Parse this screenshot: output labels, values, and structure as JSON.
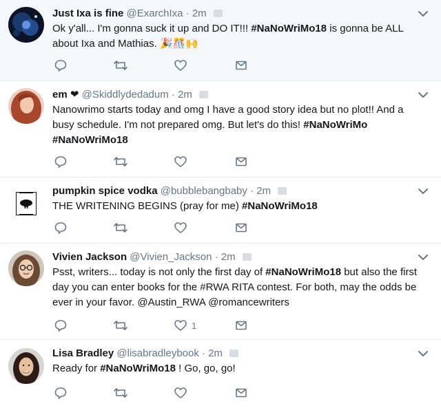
{
  "tweets": [
    {
      "name": "Just Ixa is fine",
      "handle": "@ExarchIxa",
      "separator": "·",
      "time": "2m",
      "line1": "Ok y'all... I'm gonna suck it up and DO IT!!! ",
      "hashtag1": "#NaNoWriMo18",
      "line1b": " is gonna be ALL",
      "line2": "about Ixa and Mathias. ",
      "emoji": "🎉🎊🙌",
      "avatar_icon": "galaxy-avatar-icon"
    },
    {
      "name": "em",
      "heart": "❤",
      "handle": "@Skiddlydedadum",
      "separator": "·",
      "time": "2m",
      "line1": "Nanowrimo starts today and omg I have a good story idea but no plot!! And a",
      "line2": "busy schedule. I'm not prepared omg. But let's do this! ",
      "hashtag1": "#NaNoWriMo",
      "hashtag2": "#NaNoWriMo18",
      "avatar_icon": "redhead-avatar-icon"
    },
    {
      "name": "pumpkin spice vodka",
      "handle": "@bubblebangbaby",
      "separator": "·",
      "time": "2m",
      "line1": "THE WRITENING BEGINS (pray for me) ",
      "hashtag1": "#NaNoWriMo18",
      "avatar_icon": "eye-logo-avatar-icon"
    },
    {
      "name": "Vivien Jackson",
      "handle": "@Vivien_Jackson",
      "separator": "·",
      "time": "2m",
      "line1": "Psst, writers... today is not only the first day of ",
      "hashtag1": "#NaNoWriMo18",
      "line1b": " but also the first",
      "line2": "day you can enter books for the #RWA RITA contest. For both, may the odds be",
      "line3": "ever in your favor. @Austin_RWA @romancewriters",
      "like_count": "1",
      "avatar_icon": "glasses-woman-avatar-icon"
    },
    {
      "name": "Lisa Bradley",
      "handle": "@lisabradleybook",
      "separator": "·",
      "time": "2m",
      "line1": "Ready for ",
      "hashtag1": "#NaNoWriMo18",
      "line1b": " ! Go, go, go!",
      "avatar_icon": "dark-hair-woman-avatar-icon"
    }
  ],
  "colors": {
    "text": "#14171a",
    "secondary": "#657786",
    "icon": "#657786",
    "divider": "#e6ecf0",
    "highlight_bg": "#f5f8fa"
  }
}
